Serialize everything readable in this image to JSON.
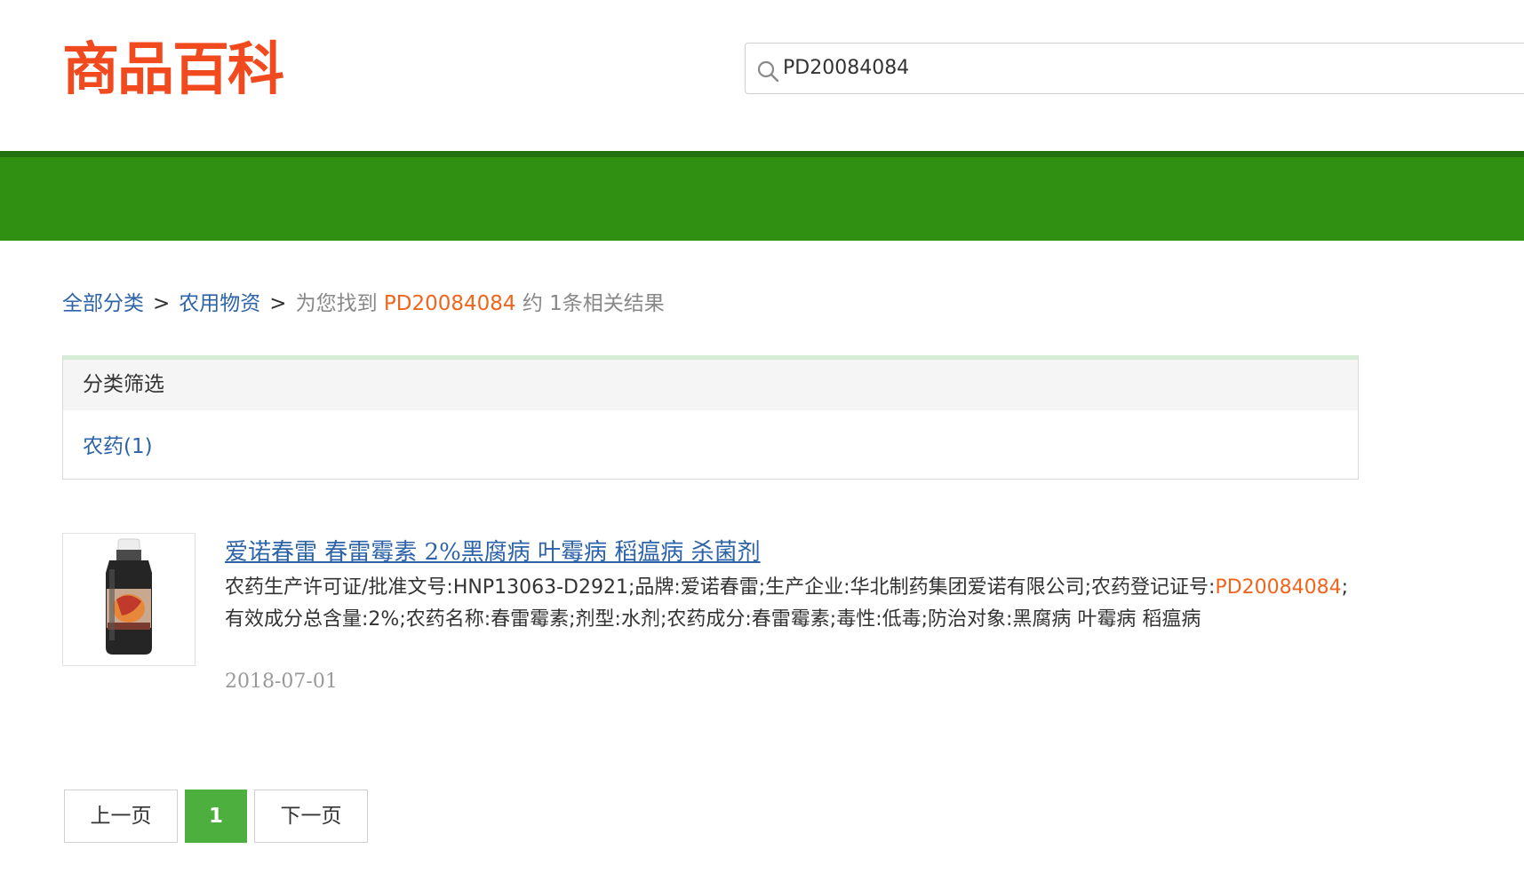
{
  "header": {
    "logo": "商品百科",
    "search": {
      "value": "PD20084084",
      "icon": "search-icon"
    }
  },
  "colors": {
    "brand_orange": "#f04a1e",
    "nav_green": "#2f9012",
    "link_blue": "#2d63a8",
    "highlight_orange": "#f0651d",
    "pager_active": "#4caf3e"
  },
  "breadcrumb": {
    "root": "全部分类",
    "category": "农用物资",
    "sep": ">",
    "prefix": "为您找到",
    "keyword": "PD20084084",
    "suffix": "约 1条相关结果"
  },
  "filter": {
    "title": "分类筛选",
    "items": [
      {
        "label": "农药(1)"
      }
    ]
  },
  "results": [
    {
      "title": "爱诺春雷 春雷霉素 2%黑腐病 叶霉病 稻瘟病 杀菌剂",
      "desc_pre": "农药生产许可证/批准文号:HNP13063-D2921;品牌:爱诺春雷;生产企业:华北制药集团爱诺有限公司;农药登记证号:",
      "desc_hl": "PD20084084",
      "desc_post": ";有效成分总含量:2%;农药名称:春雷霉素;剂型:水剂;农药成分:春雷霉素;毒性:低毒;防治对象:黑腐病 叶霉病 稻瘟病",
      "date": "2018-07-01"
    }
  ],
  "pager": {
    "prev": "上一页",
    "current": "1",
    "next": "下一页"
  }
}
